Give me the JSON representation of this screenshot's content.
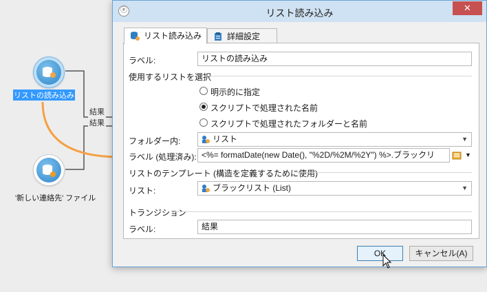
{
  "canvas": {
    "node1_label": "リストの読み込み",
    "node2_label": "'新しい連絡先' ファイル",
    "transition1": "結果",
    "transition2": "結果"
  },
  "dialog": {
    "title": "リスト読み込み",
    "close_label": "✕",
    "tabs": [
      {
        "label": "リスト読み込み"
      },
      {
        "label": "詳細設定"
      }
    ],
    "label_caption": "ラベル:",
    "label_value": "リストの読み込み",
    "section_list": "使用するリストを選択",
    "radio_explicit": "明示的に指定",
    "radio_script_name": "スクリプトで処理された名前",
    "radio_script_folder": "スクリプトで処理されたフォルダーと名前",
    "folder_caption": "フォルダー内:",
    "folder_value": "リスト",
    "processed_caption": "ラベル (処理済み):",
    "processed_value": "<%= formatDate(new Date(), \"%2D/%2M/%2Y\") %>.ブラックリ",
    "section_template": "リストのテンプレート (構造を定義するために使用)",
    "list_caption": "リスト:",
    "list_value": "ブラックリスト (List)",
    "section_transition": "トランジション",
    "transition_caption": "ラベル:",
    "transition_value": "結果",
    "ok_label": "OK",
    "cancel_label": "キャンセル(A)"
  },
  "colors": {
    "accent": "#3399ff",
    "arrow": "#f5a045",
    "node": "#2f86c9"
  }
}
